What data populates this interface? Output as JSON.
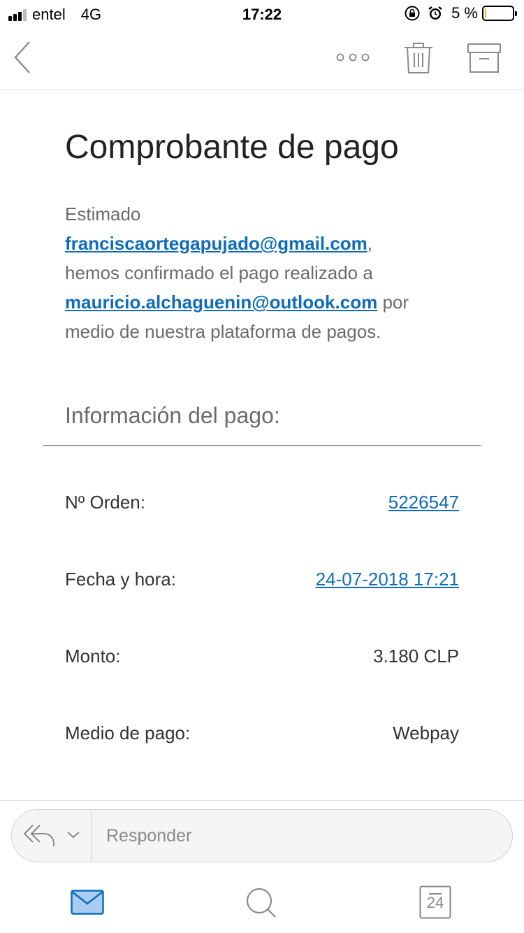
{
  "status_bar": {
    "carrier": "entel",
    "network": "4G",
    "time": "17:22",
    "battery_percent": "5 %",
    "battery_level": 0.05
  },
  "toolbar": {
    "icons": [
      "back-chevron-icon",
      "more-icon",
      "trash-icon",
      "archive-icon"
    ]
  },
  "email": {
    "subject": "Comprobante de pago",
    "greeting": "Estimado",
    "recipient_email": "franciscaortegapujado@gmail.com",
    "comma": ",",
    "confirm_text": "hemos confirmado el pago realizado a",
    "merchant_email": "mauricio.alchaguenin@outlook.com",
    "por": "por",
    "closing_text": "medio de nuestra plataforma de pagos.",
    "section_title": "Información del pago:",
    "rows": [
      {
        "label": "Nº Orden:",
        "value": "5226547"
      },
      {
        "label": "Fecha y hora:",
        "value": "24-07-2018 17:21"
      },
      {
        "label": "Monto:",
        "value": "3.180 CLP"
      },
      {
        "label": "Medio de pago:",
        "value": "Webpay"
      }
    ]
  },
  "reply": {
    "placeholder": "Responder"
  },
  "tabbar": {
    "calendar_day": "24",
    "accent_color": "#0f6cbd"
  }
}
